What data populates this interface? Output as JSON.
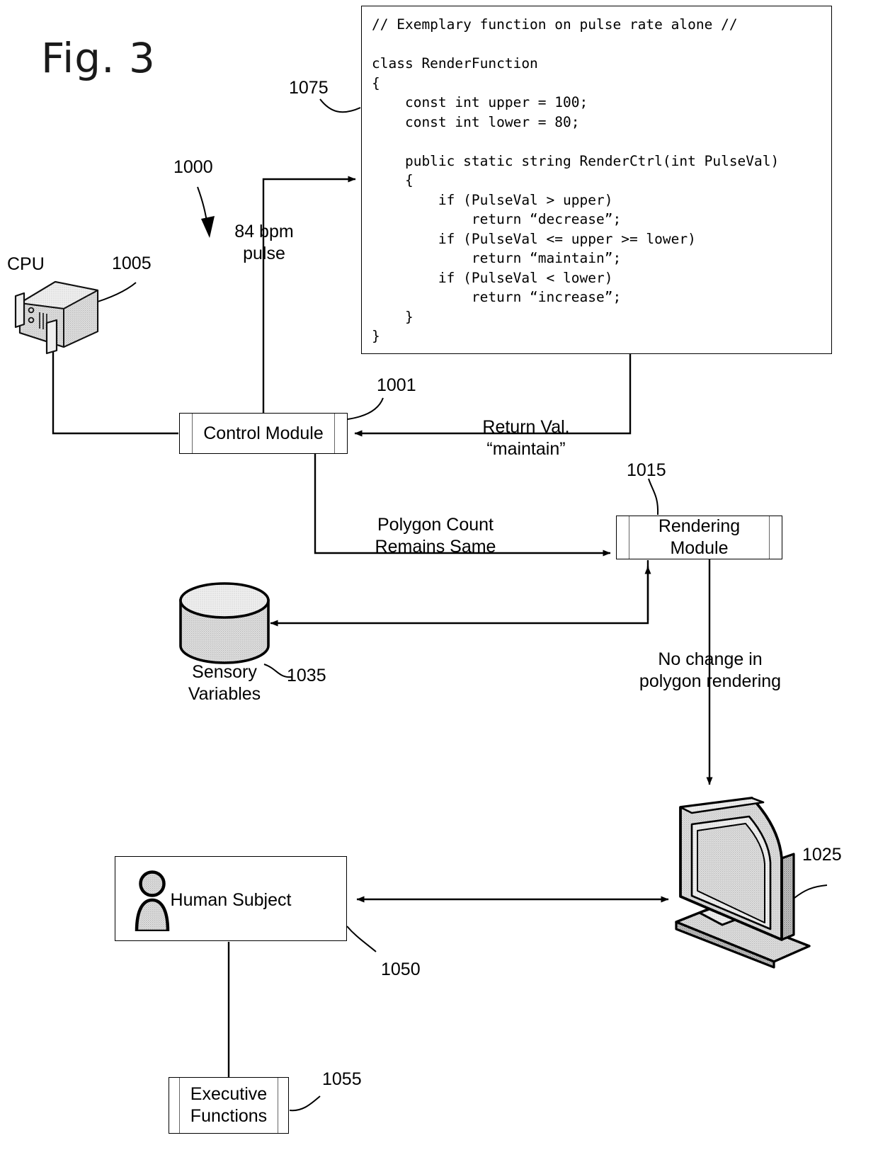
{
  "figure": {
    "label": "Fig. 3",
    "overall_ref": "1000"
  },
  "code_panel": {
    "ref": "1075",
    "listing": "// Exemplary function on pulse rate alone //\n\nclass RenderFunction\n{\n    const int upper = 100;\n    const int lower = 80;\n\n    public static string RenderCtrl(int PulseVal)\n    {\n        if (PulseVal > upper)\n            return “decrease”;\n        if (PulseVal <= upper >= lower)\n            return “maintain”;\n        if (PulseVal < lower)\n            return “increase”;\n    }\n}"
  },
  "nodes": {
    "cpu": {
      "label": "CPU",
      "ref": "1005",
      "icon": "server-icon"
    },
    "control_module": {
      "label": "Control Module",
      "ref": "1001"
    },
    "rendering_module": {
      "label": "Rendering\nModule",
      "ref": "1015"
    },
    "sensory_variables": {
      "label": "Sensory\nVariables",
      "ref": "1035",
      "icon": "database-cylinder-icon"
    },
    "display": {
      "ref": "1025",
      "icon": "monitor-icon"
    },
    "human_subject": {
      "label": "Human Subject",
      "ref": "1050",
      "icon": "person-icon"
    },
    "executive_functions": {
      "label": "Executive\nFunctions",
      "ref": "1055"
    }
  },
  "edges": {
    "pulse": "84 bpm\npulse",
    "return_value": "Return Val.\n“maintain”",
    "polygon_count": "Polygon Count\nRemains Same",
    "no_change": "No change in\npolygon rendering"
  },
  "colors": {
    "line": "#000000",
    "shape_fill": "#ffffff",
    "shading_light": "#d8d8d8",
    "shading_mid": "#c2c2c2",
    "shading_dark": "#a8a8a8"
  }
}
